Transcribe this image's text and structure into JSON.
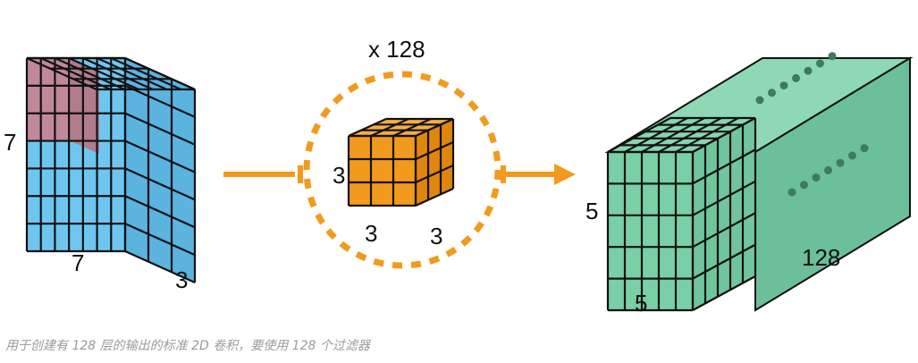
{
  "diagram": {
    "input_volume": {
      "width_label": "7",
      "height_label": "7",
      "depth_label": "3",
      "colors": {
        "front": "#6EC6F0",
        "side": "#5BB3E0",
        "top": "#86D3F5",
        "highlight": "#C08898",
        "highlight_top": "#CC97A5",
        "grid": "#111111"
      }
    },
    "kernel": {
      "multiplier_label": "x 128",
      "height_label": "3",
      "width_label": "3",
      "depth_label": "3",
      "colors": {
        "front": "#F29A1E",
        "side": "#E0860E",
        "top": "#F7AE3E",
        "ring": "#F29A1E"
      }
    },
    "output_volume": {
      "height_label": "5",
      "width_label": "5",
      "depth_label": "128",
      "colors": {
        "front": "#79CFA6",
        "side": "#6BC099",
        "top": "#8ED9B4",
        "dots": "#3E7A5C"
      }
    },
    "arrow_color": "#F29A1E"
  },
  "caption": "用于创建有 128 层的输出的标准 2D 卷积，要使用 128 个过滤器"
}
